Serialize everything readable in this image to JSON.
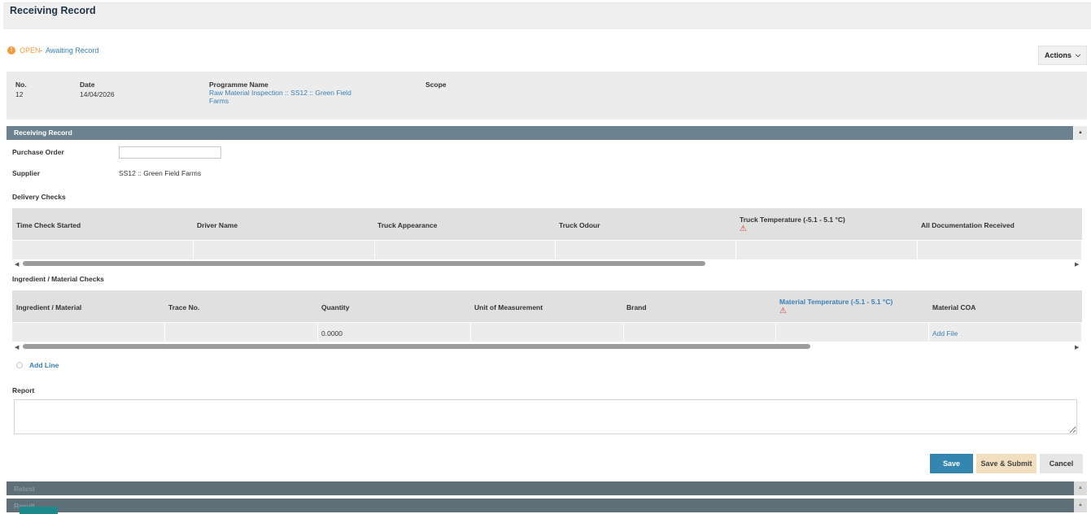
{
  "page": {
    "title": "Receiving Record"
  },
  "status": {
    "state": "OPEN",
    "separator": "-",
    "text": "Awaiting Record"
  },
  "actions": {
    "label": "Actions"
  },
  "info": {
    "no_label": "No.",
    "no_value": "12",
    "date_label": "Date",
    "date_value": "14/04/2026",
    "programme_label": "Programme Name",
    "programme_value": "Raw Material Inspection :: SS12 :: Green Field Farms",
    "scope_label": "Scope"
  },
  "section": {
    "title": "Receiving Record"
  },
  "form": {
    "purchase_order_label": "Purchase Order",
    "purchase_order_value": "",
    "supplier_label": "Supplier",
    "supplier_value": "SS12 :: Green Field Farms"
  },
  "delivery_checks": {
    "title": "Delivery Checks",
    "columns": [
      "Time Check Started",
      "Driver Name",
      "Truck Appearance",
      "Truck Odour",
      "Truck Temperature (-5.1 - 5.1 °C)",
      "All Documentation Received"
    ],
    "rows": [
      [
        "",
        "",
        "",
        "",
        "",
        ""
      ]
    ],
    "scroll_fraction": 0.65
  },
  "ingredient_checks": {
    "title": "Ingredient / Material Checks",
    "columns": [
      "Ingredient / Material",
      "Trace No.",
      "Quantity",
      "Unit of Measurement",
      "Brand",
      "Material Temperature (-5.1 - 5.1 °C)",
      "Material COA"
    ],
    "rows": [
      [
        "",
        "",
        "0.0000",
        "",
        "",
        "",
        "Add File"
      ]
    ],
    "scroll_fraction": 0.75
  },
  "add_line": {
    "label": "Add Line"
  },
  "report": {
    "label": "Report",
    "value": ""
  },
  "buttons": {
    "save": "Save",
    "save_submit": "Save & Submit",
    "cancel": "Cancel"
  },
  "bottom_sections": [
    {
      "title": "Retest"
    },
    {
      "title": "Result"
    }
  ],
  "icons": {
    "status": "info-circle-icon",
    "warning": "warning-triangle-icon",
    "chevron": "chevron-down-icon",
    "collapse": "caret-up-icon"
  },
  "colors": {
    "status_open": "#f39a3b",
    "link": "#3a7fb5",
    "section_bar": "#6c8290",
    "save": "#3585b1",
    "save_submit": "#f1dfc0",
    "warning": "#d9342b"
  }
}
